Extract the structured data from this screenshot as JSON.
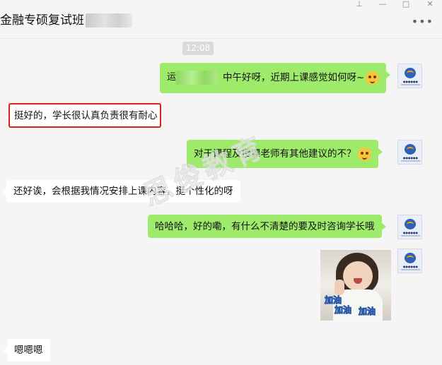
{
  "window": {
    "title": "金融专硕复试班",
    "controls": [
      "pin-icon",
      "minimize-icon",
      "maximize-icon",
      "close-icon"
    ],
    "more_label": "•••"
  },
  "timestamp": "12:08",
  "messages": [
    {
      "side": "right",
      "text": "中午好呀，近期上课感觉如何呀~",
      "prefix": "",
      "has_emoji": true
    },
    {
      "side": "left",
      "text": "挺好的，学长很认真负责很有耐心"
    },
    {
      "side": "right",
      "text": "对于课程及授课老师有其他建议的不？",
      "has_emoji": true
    },
    {
      "side": "left",
      "text": "还好诶，会根据我情况安排上课内容，挺个性化的呀"
    },
    {
      "side": "right",
      "text": "哈哈哈，好的嘞，有什么不清楚的要及时咨询学长哦"
    },
    {
      "side": "right",
      "type": "image",
      "stickers": [
        "加油",
        "加油",
        "加油"
      ]
    },
    {
      "side": "left",
      "text": "嗯嗯嗯"
    }
  ],
  "watermark": "思俊教育",
  "colors": {
    "green_bubble": "#9eea6a",
    "white_bubble": "#ffffff",
    "background": "#f5f5f5",
    "highlight": "#e0201f"
  }
}
